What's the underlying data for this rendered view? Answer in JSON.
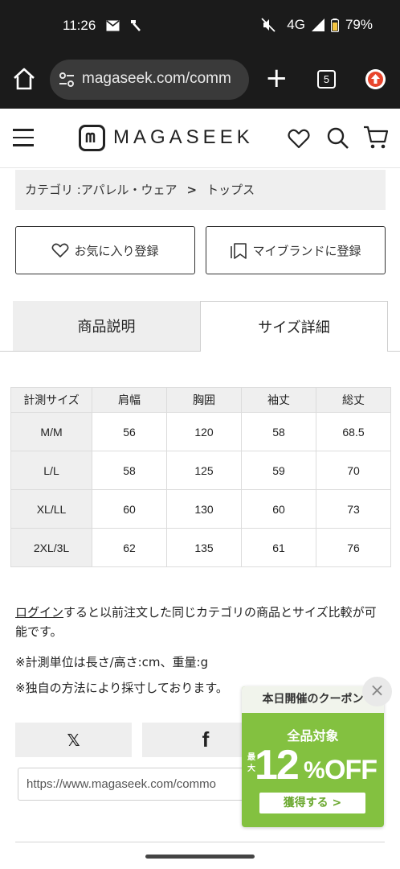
{
  "status_bar": {
    "time": "11:26",
    "network": "4G",
    "battery": "79%",
    "icons": [
      "mail-icon",
      "hammer-icon",
      "mute-icon",
      "signal-icon",
      "battery-icon"
    ]
  },
  "browser": {
    "url": "magaseek.com/comm",
    "tab_count": "5",
    "plus_label": "+"
  },
  "header": {
    "logo_text": "MAGASEEK"
  },
  "breadcrumb": {
    "category_label": "カテゴリ :アパレル・ウェア",
    "separator": ">",
    "current": "トップス"
  },
  "actions": {
    "favorite_label": "お気に入り登録",
    "brand_label": "マイブランドに登録"
  },
  "tabs": [
    {
      "label": "商品説明",
      "active": false
    },
    {
      "label": "サイズ詳細",
      "active": true
    }
  ],
  "size_table": {
    "headers": [
      "計測サイズ",
      "肩幅",
      "胸囲",
      "袖丈",
      "総丈"
    ],
    "rows": [
      [
        "M/M",
        "56",
        "120",
        "58",
        "68.5"
      ],
      [
        "L/L",
        "58",
        "125",
        "59",
        "70"
      ],
      [
        "XL/LL",
        "60",
        "130",
        "60",
        "73"
      ],
      [
        "2XL/3L",
        "62",
        "135",
        "61",
        "76"
      ]
    ]
  },
  "notes": {
    "login_link": "ログイン",
    "login_text_1": "すると以前注文した同じカテゴリの商品とサイズ比較が可",
    "login_text_2": "能です。",
    "unit_note": "※計測単位は長さ/高さ:cm、重量:g",
    "method_note": "※独自の方法により採寸しております。"
  },
  "share": {
    "x_label": "𝕏",
    "facebook_label": "f",
    "url": "https://www.magaseek.com/commo"
  },
  "coupon": {
    "title": "本日開催のクーポン",
    "subtitle": "全品対象",
    "max_label": "最大",
    "amount": "12",
    "percent": "%",
    "off": "OFF",
    "cta": "獲得する >",
    "close": "×",
    "color": "#83c140"
  },
  "colors": {
    "brand_green": "#83c140",
    "chrome_dark": "#1b1b1b"
  }
}
